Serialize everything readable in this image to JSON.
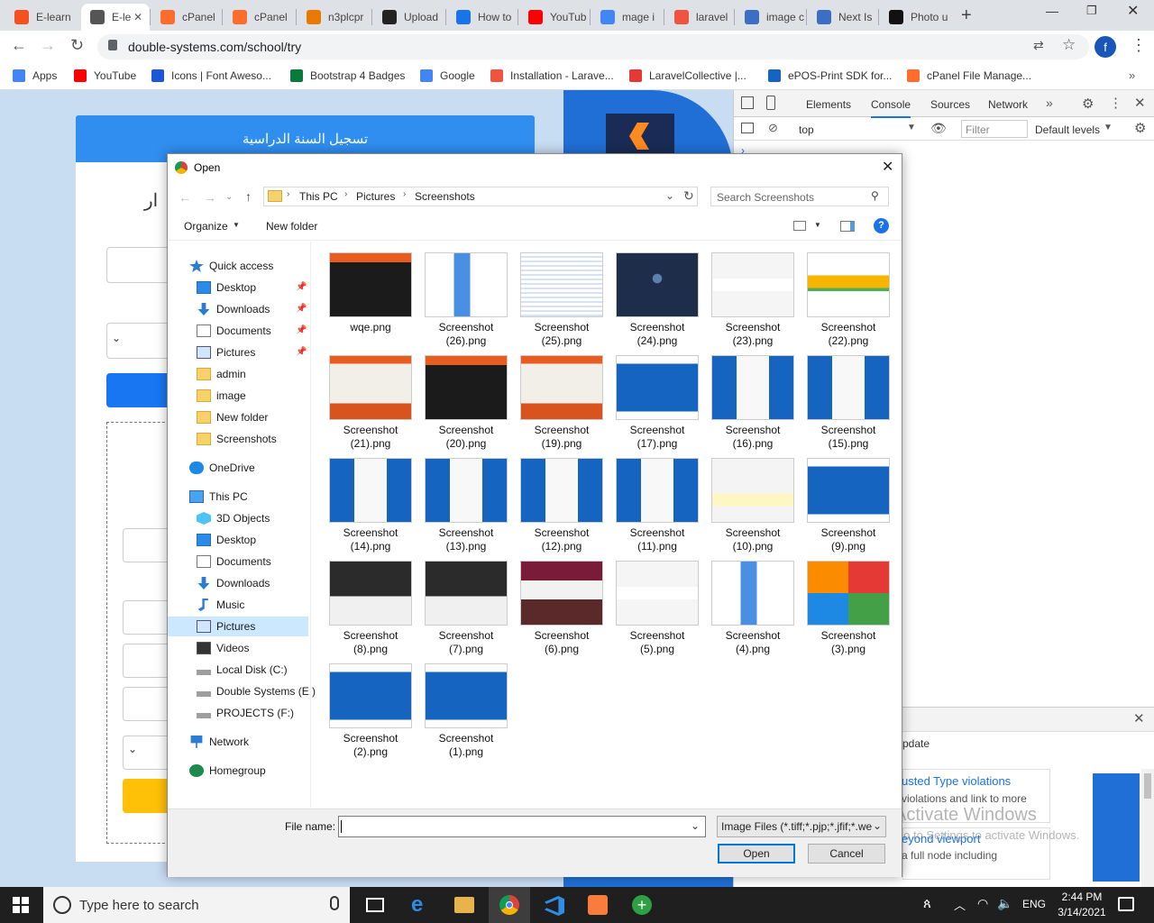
{
  "browser": {
    "tabs": [
      {
        "label": "E-learn",
        "color": "#f4511e"
      },
      {
        "label": "E-le",
        "color": "#555555"
      },
      {
        "label": "cPanel",
        "color": "#ff6c2c"
      },
      {
        "label": "cPanel",
        "color": "#ff6c2c"
      },
      {
        "label": "n3plcpr",
        "color": "#e97a00"
      },
      {
        "label": "Upload",
        "color": "#222222"
      },
      {
        "label": "How to",
        "color": "#1a73e8"
      },
      {
        "label": "YouTub",
        "color": "#ff0000"
      },
      {
        "label": "mage i",
        "color": "#4285f4"
      },
      {
        "label": "laravel",
        "color": "#f05340"
      },
      {
        "label": "image c",
        "color": "#3c6ec4"
      },
      {
        "label": "Next Is",
        "color": "#3c6ec4"
      },
      {
        "label": "Photo u",
        "color": "#111111"
      }
    ],
    "url": "double-systems.com/school/try",
    "profile_initial": "f",
    "bookmarks": [
      {
        "label": "Apps",
        "color": "#4285f4"
      },
      {
        "label": "YouTube",
        "color": "#ff0000"
      },
      {
        "label": "Icons | Font Aweso...",
        "color": "#1c58d6"
      },
      {
        "label": "Bootstrap 4 Badges",
        "color": "#0a7a3b"
      },
      {
        "label": "Google",
        "color": "#4285f4"
      },
      {
        "label": "Installation - Larave...",
        "color": "#f05340"
      },
      {
        "label": "LaravelCollective |...",
        "color": "#e53935"
      },
      {
        "label": "ePOS-Print SDK for...",
        "color": "#1565c0"
      },
      {
        "label": "cPanel File Manage...",
        "color": "#ff6c2c"
      }
    ]
  },
  "website": {
    "header_title": "تسجيل السنة الدراسية",
    "partial_text": "ار"
  },
  "devtools": {
    "tabs": [
      "Elements",
      "Console",
      "Sources",
      "Network"
    ],
    "active_tab": "Console",
    "context": "top",
    "filter_placeholder": "Filter",
    "levels": "Default levels",
    "issues_header": "pdate",
    "issue1_link": "usted Type violations",
    "issue1_text": "violations and link to more",
    "issue2_link": "eyond viewport",
    "issue2_text": "a full node including",
    "watermark1": "Activate Windows",
    "watermark2": "Go to Settings to activate Windows."
  },
  "dialog": {
    "title": "Open",
    "breadcrumb": [
      "This PC",
      "Pictures",
      "Screenshots"
    ],
    "search_placeholder": "Search Screenshots",
    "organize": "Organize",
    "new_folder": "New folder",
    "nav": [
      {
        "label": "Quick access",
        "indent": 0,
        "pin": false,
        "icon": "star"
      },
      {
        "label": "Desktop",
        "indent": 1,
        "pin": true,
        "icon": "desktop"
      },
      {
        "label": "Downloads",
        "indent": 1,
        "pin": true,
        "icon": "download"
      },
      {
        "label": "Documents",
        "indent": 1,
        "pin": true,
        "icon": "doc"
      },
      {
        "label": "Pictures",
        "indent": 1,
        "pin": true,
        "icon": "picture"
      },
      {
        "label": "admin",
        "indent": 1,
        "pin": false,
        "icon": "folder"
      },
      {
        "label": "image",
        "indent": 1,
        "pin": false,
        "icon": "folder"
      },
      {
        "label": "New folder",
        "indent": 1,
        "pin": false,
        "icon": "folder"
      },
      {
        "label": "Screenshots",
        "indent": 1,
        "pin": false,
        "icon": "folder"
      },
      {
        "label": "OneDrive",
        "indent": 0,
        "pin": false,
        "icon": "cloud"
      },
      {
        "label": "This PC",
        "indent": 0,
        "pin": false,
        "icon": "pc"
      },
      {
        "label": "3D Objects",
        "indent": 1,
        "pin": false,
        "icon": "cube"
      },
      {
        "label": "Desktop",
        "indent": 1,
        "pin": false,
        "icon": "desktop"
      },
      {
        "label": "Documents",
        "indent": 1,
        "pin": false,
        "icon": "doc"
      },
      {
        "label": "Downloads",
        "indent": 1,
        "pin": false,
        "icon": "download"
      },
      {
        "label": "Music",
        "indent": 1,
        "pin": false,
        "icon": "music"
      },
      {
        "label": "Pictures",
        "indent": 1,
        "pin": false,
        "icon": "picture",
        "selected": true
      },
      {
        "label": "Videos",
        "indent": 1,
        "pin": false,
        "icon": "video"
      },
      {
        "label": "Local Disk (C:)",
        "indent": 1,
        "pin": false,
        "icon": "disk"
      },
      {
        "label": "Double Systems (E:)",
        "indent": 1,
        "pin": false,
        "icon": "disk"
      },
      {
        "label": "PROJECTS (F:)",
        "indent": 1,
        "pin": false,
        "icon": "disk"
      },
      {
        "label": "Network",
        "indent": 0,
        "pin": false,
        "icon": "network"
      },
      {
        "label": "Homegroup",
        "indent": 0,
        "pin": false,
        "icon": "homegroup"
      }
    ],
    "files": [
      {
        "line1": "wqe.png",
        "line2": "",
        "style": "orange-dark"
      },
      {
        "line1": "Screenshot",
        "line2": "(26).png",
        "style": "browser-blue"
      },
      {
        "line1": "Screenshot",
        "line2": "(25).png",
        "style": "code"
      },
      {
        "line1": "Screenshot",
        "line2": "(24).png",
        "style": "navy-login"
      },
      {
        "line1": "Screenshot",
        "line2": "(23).png",
        "style": "timer"
      },
      {
        "line1": "Screenshot",
        "line2": "(22).png",
        "style": "pricing"
      },
      {
        "line1": "Screenshot",
        "line2": "(21).png",
        "style": "house"
      },
      {
        "line1": "Screenshot",
        "line2": "(20).png",
        "style": "orange-dark"
      },
      {
        "line1": "Screenshot",
        "line2": "(19).png",
        "style": "house"
      },
      {
        "line1": "Screenshot",
        "line2": "(17).png",
        "style": "blue-grid"
      },
      {
        "line1": "Screenshot",
        "line2": "(16).png",
        "style": "blue-grid-popup"
      },
      {
        "line1": "Screenshot",
        "line2": "(15).png",
        "style": "blue-grid-popup"
      },
      {
        "line1": "Screenshot",
        "line2": "(14).png",
        "style": "blue-grid-popup"
      },
      {
        "line1": "Screenshot",
        "line2": "(13).png",
        "style": "blue-grid-popup"
      },
      {
        "line1": "Screenshot",
        "line2": "(12).png",
        "style": "blue-grid-popup"
      },
      {
        "line1": "Screenshot",
        "line2": "(11).png",
        "style": "blue-grid-popup"
      },
      {
        "line1": "Screenshot",
        "line2": "(10).png",
        "style": "white-form"
      },
      {
        "line1": "Screenshot",
        "line2": "(9).png",
        "style": "blue-grid"
      },
      {
        "line1": "Screenshot",
        "line2": "(8).png",
        "style": "video-call"
      },
      {
        "line1": "Screenshot",
        "line2": "(7).png",
        "style": "video-call"
      },
      {
        "line1": "Screenshot",
        "line2": "(6).png",
        "style": "maroon"
      },
      {
        "line1": "Screenshot",
        "line2": "(5).png",
        "style": "timer"
      },
      {
        "line1": "Screenshot",
        "line2": "(4).png",
        "style": "browser-blue"
      },
      {
        "line1": "Screenshot",
        "line2": "(3).png",
        "style": "colorful-tiles"
      },
      {
        "line1": "Screenshot",
        "line2": "(2).png",
        "style": "blue-grid"
      },
      {
        "line1": "Screenshot",
        "line2": "(1).png",
        "style": "blue-grid"
      }
    ],
    "file_name_label": "File name:",
    "file_name_value": "",
    "file_type": "Image Files (*.tiff;*.pjp;*.jfif;*.we",
    "open_label": "Open",
    "cancel_label": "Cancel"
  },
  "taskbar": {
    "search_placeholder": "Type here to search",
    "language": "ENG",
    "time": "2:44 PM",
    "date": "3/14/2021"
  }
}
